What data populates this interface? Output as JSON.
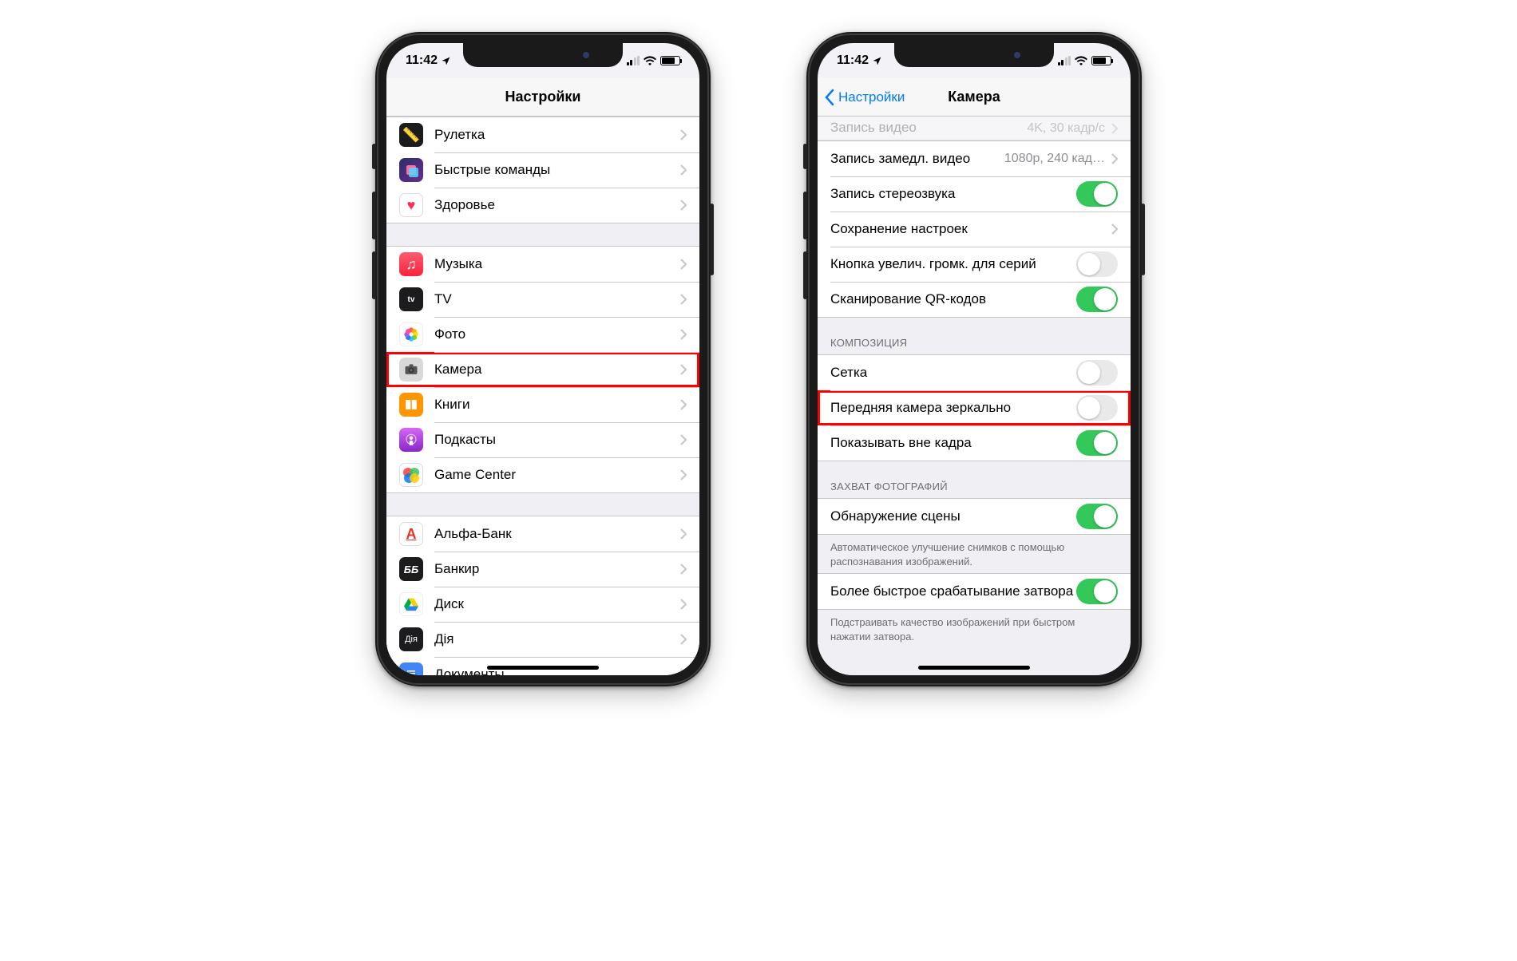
{
  "status": {
    "time": "11:42",
    "loc_arrow": "➤"
  },
  "left": {
    "title": "Настройки",
    "group1": [
      {
        "label": "Рулетка",
        "icon": "ruler"
      },
      {
        "label": "Быстрые команды",
        "icon": "shortcuts"
      },
      {
        "label": "Здоровье",
        "icon": "health"
      }
    ],
    "group2": [
      {
        "label": "Музыка",
        "icon": "music"
      },
      {
        "label": "TV",
        "icon": "tv"
      },
      {
        "label": "Фото",
        "icon": "photos"
      },
      {
        "label": "Камера",
        "icon": "camera",
        "highlight": true
      },
      {
        "label": "Книги",
        "icon": "books"
      },
      {
        "label": "Подкасты",
        "icon": "podcasts"
      },
      {
        "label": "Game Center",
        "icon": "gamecenter"
      }
    ],
    "group3": [
      {
        "label": "Альфа-Банк",
        "icon": "alfa"
      },
      {
        "label": "Банкир",
        "icon": "bb"
      },
      {
        "label": "Диск",
        "icon": "drive"
      },
      {
        "label": "Дія",
        "icon": "diia"
      },
      {
        "label": "Документы",
        "icon": "docs"
      }
    ]
  },
  "right": {
    "back": "Настройки",
    "title": "Камера",
    "cut_row": {
      "label": "Запись видео",
      "value": "4K, 30 кадр/с"
    },
    "g1": [
      {
        "label": "Запись замедл. видео",
        "type": "link",
        "value": "1080p, 240 кад…"
      },
      {
        "label": "Запись стереозвука",
        "type": "toggle",
        "on": true
      },
      {
        "label": "Сохранение настроек",
        "type": "link",
        "value": ""
      },
      {
        "label": "Кнопка увелич. громк. для серий",
        "type": "toggle",
        "on": false
      },
      {
        "label": "Сканирование QR-кодов",
        "type": "toggle",
        "on": true
      }
    ],
    "h2": "КОМПОЗИЦИЯ",
    "g2": [
      {
        "label": "Сетка",
        "type": "toggle",
        "on": false
      },
      {
        "label": "Передняя камера зеркально",
        "type": "toggle",
        "on": false,
        "highlight": true
      },
      {
        "label": "Показывать вне кадра",
        "type": "toggle",
        "on": true
      }
    ],
    "h3": "ЗАХВАТ ФОТОГРАФИЙ",
    "g3": [
      {
        "label": "Обнаружение сцены",
        "type": "toggle",
        "on": true
      }
    ],
    "f3": "Автоматическое улучшение снимков с помощью распознавания изображений.",
    "g4": [
      {
        "label": "Более быстрое срабатывание затвора",
        "type": "toggle",
        "on": true
      }
    ],
    "f4": "Подстраивать качество изображений при быстром нажатии затвора."
  }
}
